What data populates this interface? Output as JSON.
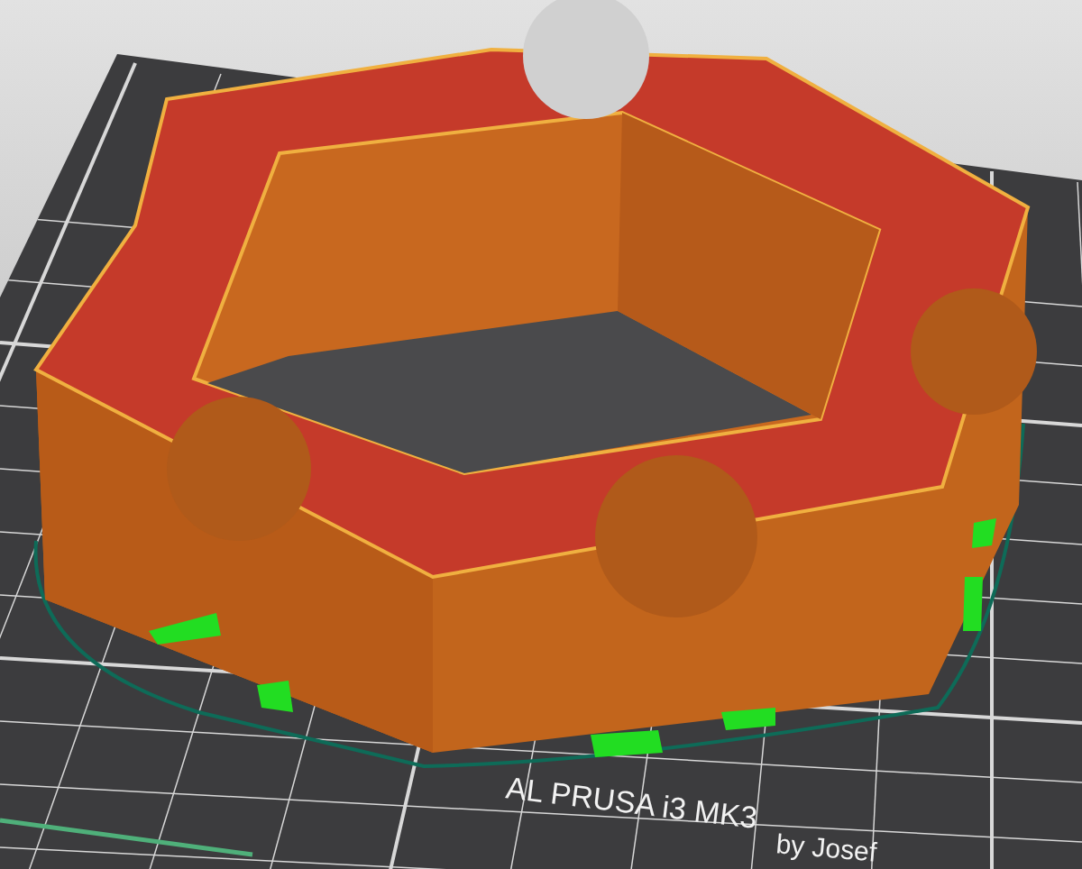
{
  "viewport": {
    "bed_label": [
      "AL PRUSA i3  MK3",
      "by Josef"
    ]
  }
}
